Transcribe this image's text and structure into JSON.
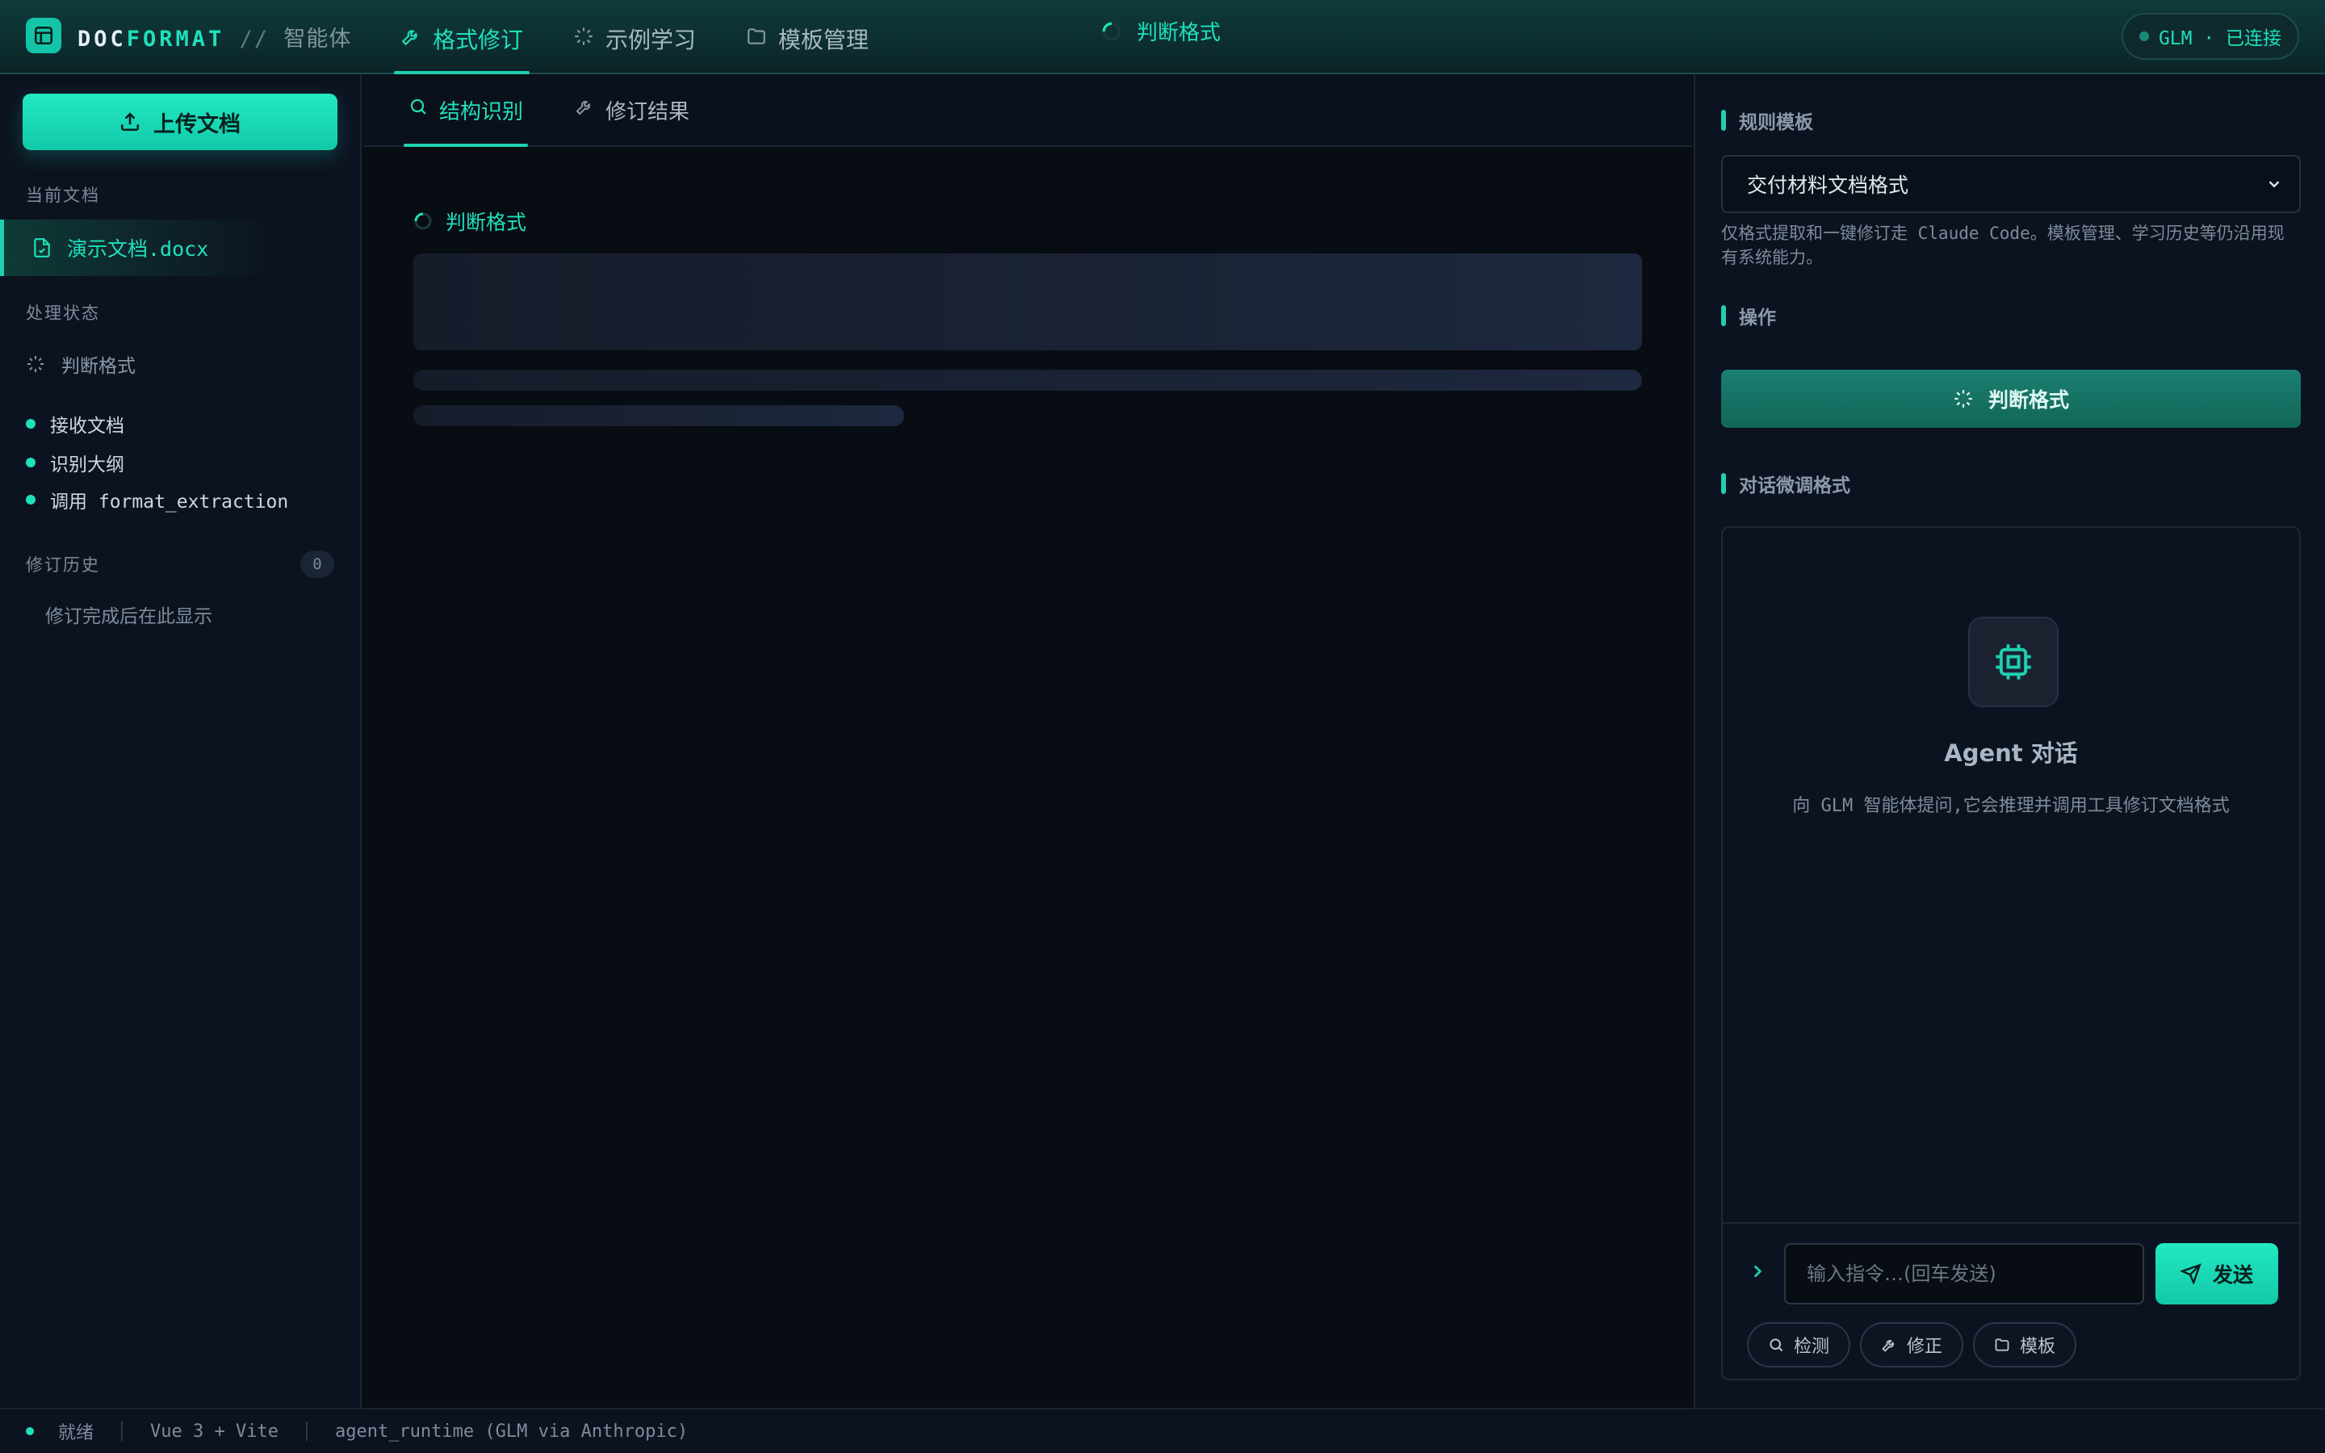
{
  "header": {
    "logo_prefix": "DOC",
    "logo_accent": "FORMAT",
    "logo_separator": " // ",
    "logo_sub": "智能体",
    "nav": [
      {
        "label": "格式修订",
        "icon": "wrench-icon"
      },
      {
        "label": "示例学习",
        "icon": "loader-icon"
      },
      {
        "label": "模板管理",
        "icon": "folder-icon"
      }
    ],
    "active_nav": "格式修订",
    "status_text": "判断格式",
    "connection": "GLM · 已连接"
  },
  "sidebar": {
    "upload_label": "上传文档",
    "current_doc_label": "当前文档",
    "current_doc_name": "演示文档.docx",
    "process_label": "处理状态",
    "process_current": "判断格式",
    "steps": [
      {
        "label": "接收文档"
      },
      {
        "label": "识别大纲"
      },
      {
        "label": "调用 format_extraction"
      }
    ],
    "history_label": "修订历史",
    "history_count": "0",
    "history_empty": "修订完成后在此显示"
  },
  "main": {
    "tabs": [
      {
        "label": "结构识别",
        "icon": "search-icon"
      },
      {
        "label": "修订结果",
        "icon": "wrench-icon"
      }
    ],
    "active_tab": "结构识别",
    "loading_text": "判断格式"
  },
  "right": {
    "template_section": "规则模板",
    "template_selected": "交付材料文档格式",
    "template_note": "仅格式提取和一键修订走 Claude Code。模板管理、学习历史等仍沿用现有系统能力。",
    "actions_section": "操作",
    "action_button": "判断格式",
    "chat_section": "对话微调格式",
    "agent_title": "Agent 对话",
    "agent_desc": "向 GLM 智能体提问,它会推理并调用工具修订文档格式",
    "input_placeholder": "输入指令…(回车发送)",
    "send_label": "发送",
    "chips": [
      {
        "label": "检测",
        "icon": "search-icon"
      },
      {
        "label": "修正",
        "icon": "wrench-icon"
      },
      {
        "label": "模板",
        "icon": "folder-icon"
      }
    ]
  },
  "statusbar": {
    "state": "就绪",
    "stack": "Vue 3 + Vite",
    "runtime": "agent_runtime (GLM via Anthropic)"
  },
  "colors": {
    "accent": "#1fe0bb",
    "background": "#0a0e15",
    "panel": "#0c1320"
  }
}
